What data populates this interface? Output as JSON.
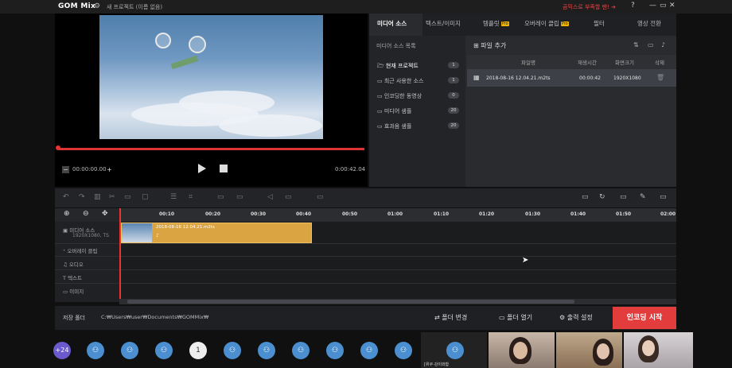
{
  "app": {
    "logo": "GOM Mix",
    "project_title": "새 프로젝트 (이름 없음)",
    "promo": "곰믹스로 부족할 땐! ➔",
    "help": "?",
    "win_min": "—",
    "win_max": "▭",
    "win_close": "✕"
  },
  "preview": {
    "current_time": "00:00:00.00",
    "duration": "0:00:42.04"
  },
  "tabs": [
    {
      "label": "미디어 소스"
    },
    {
      "label": "텍스트/이미지"
    },
    {
      "label": "템플릿",
      "pro": "Pro"
    },
    {
      "label": "오버레이 클립",
      "pro": "Pro"
    },
    {
      "label": "필터"
    },
    {
      "label": "영상 전환"
    }
  ],
  "media": {
    "list_title": "미디어 소스 목록",
    "add_file": "파일 추가",
    "sources": [
      {
        "label": "현재 프로젝트",
        "count": "1"
      },
      {
        "label": "최근 사용한 소스",
        "count": "1"
      },
      {
        "label": "인코딩한 동영상",
        "count": "0"
      },
      {
        "label": "미디어 샘플",
        "count": "20"
      },
      {
        "label": "효과음 샘플",
        "count": "20"
      }
    ],
    "columns": [
      "파일명",
      "재생시간",
      "화면크기",
      "삭제"
    ],
    "files": [
      {
        "name": "2018-08-16 12.04.21.m2ts",
        "duration": "00:00:42",
        "size": "1920X1080"
      }
    ]
  },
  "ruler": {
    "ticks": [
      "00:10",
      "00:20",
      "00:30",
      "00:40",
      "00:50",
      "01:00",
      "01:10",
      "01:20",
      "01:30",
      "01:40",
      "01:50",
      "02:00"
    ]
  },
  "tracks": {
    "media": "미디어 소스",
    "media_info": "1920X1080, TS",
    "overlay": "오버레이 클립",
    "audio": "오디오",
    "text": "텍스트",
    "image": "이미지"
  },
  "clip": {
    "name": "2018-08-16 12.04.21.m2ts"
  },
  "bottom": {
    "save_folder_label": "저장 폴더",
    "save_path": "C:₩Users₩user₩Documents₩GOMMix₩",
    "change_folder": "폴더 변경",
    "open_folder": "폴더 열기",
    "output_settings": "출력 설정",
    "start_encoding": "인코딩 시작"
  },
  "participants": {
    "more": "+24",
    "pinned": "1",
    "caption": "[위쿠·강이와함"
  }
}
